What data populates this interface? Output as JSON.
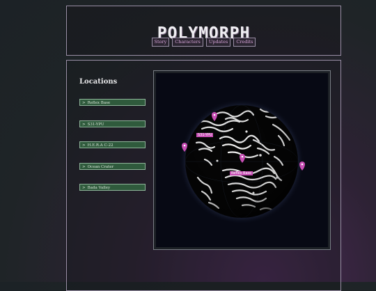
{
  "header": {
    "logo_text": "POLYMORPH",
    "nav": [
      "Story",
      "Characters",
      "Updates",
      "Credits"
    ]
  },
  "locations": {
    "title": "Locations",
    "items": [
      "Reflex Base",
      "S31-YPU",
      "H.E.R.A C-22",
      "Ocean Crater",
      "Bada Valley"
    ]
  },
  "map": {
    "labels": {
      "s31": "S31-YPU",
      "reflex": "Reflex Base"
    },
    "pin_color": "#c84fb5"
  },
  "colors": {
    "accent": "#d7a5d9",
    "list_bg": "#2f5a3c",
    "list_border": "#8fb59a"
  }
}
